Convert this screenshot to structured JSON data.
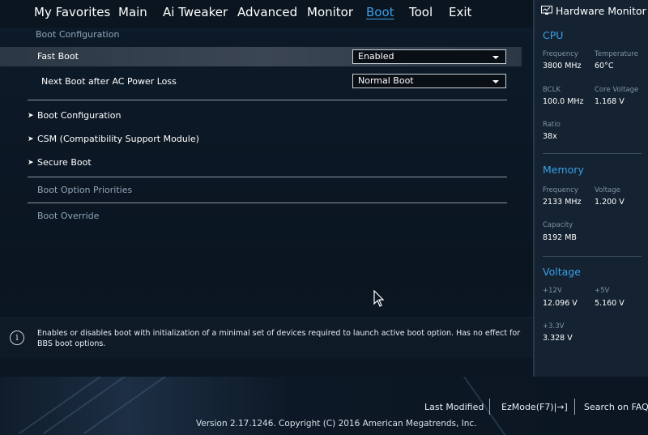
{
  "menu": {
    "items": [
      "My Favorites",
      "Main",
      "Ai Tweaker",
      "Advanced",
      "Monitor",
      "Boot",
      "Tool",
      "Exit"
    ],
    "active": "Boot"
  },
  "breadcrumb": "Boot Configuration",
  "settings": {
    "fast_boot": {
      "label": "Fast Boot",
      "value": "Enabled"
    },
    "ac_power_loss": {
      "label": "Next Boot after AC Power Loss",
      "value": "Normal Boot"
    }
  },
  "submenus": {
    "boot_config": "Boot Configuration",
    "csm": "CSM (Compatibility Support Module)",
    "secure_boot": "Secure Boot"
  },
  "sections": {
    "boot_option_priorities": "Boot Option Priorities",
    "boot_override": "Boot Override"
  },
  "help": {
    "text": "Enables or disables boot with initialization of a minimal set of devices required to launch active boot option. Has no effect for BBS boot options."
  },
  "footer": {
    "last_modified": "Last Modified",
    "ezmode": "EzMode(F7)|→]",
    "search": "Search on FAQ",
    "version": "Version 2.17.1246. Copyright (C) 2016 American Megatrends, Inc."
  },
  "hardware_monitor": {
    "title": "Hardware Monitor",
    "cpu": {
      "section": "CPU",
      "frequency_label": "Frequency",
      "frequency": "3800 MHz",
      "temperature_label": "Temperature",
      "temperature": "60°C",
      "bclk_label": "BCLK",
      "bclk": "100.0 MHz",
      "core_voltage_label": "Core Voltage",
      "core_voltage": "1.168 V",
      "ratio_label": "Ratio",
      "ratio": "38x"
    },
    "memory": {
      "section": "Memory",
      "frequency_label": "Frequency",
      "frequency": "2133 MHz",
      "voltage_label": "Voltage",
      "voltage": "1.200 V",
      "capacity_label": "Capacity",
      "capacity": "8192 MB"
    },
    "voltage": {
      "section": "Voltage",
      "v12_label": "+12V",
      "v12": "12.096 V",
      "v5_label": "+5V",
      "v5": "5.160 V",
      "v33_label": "+3.3V",
      "v33": "3.328 V"
    }
  },
  "colors": {
    "accent": "#3aa0e8",
    "background": "#0b1622",
    "panel": "#142231"
  }
}
